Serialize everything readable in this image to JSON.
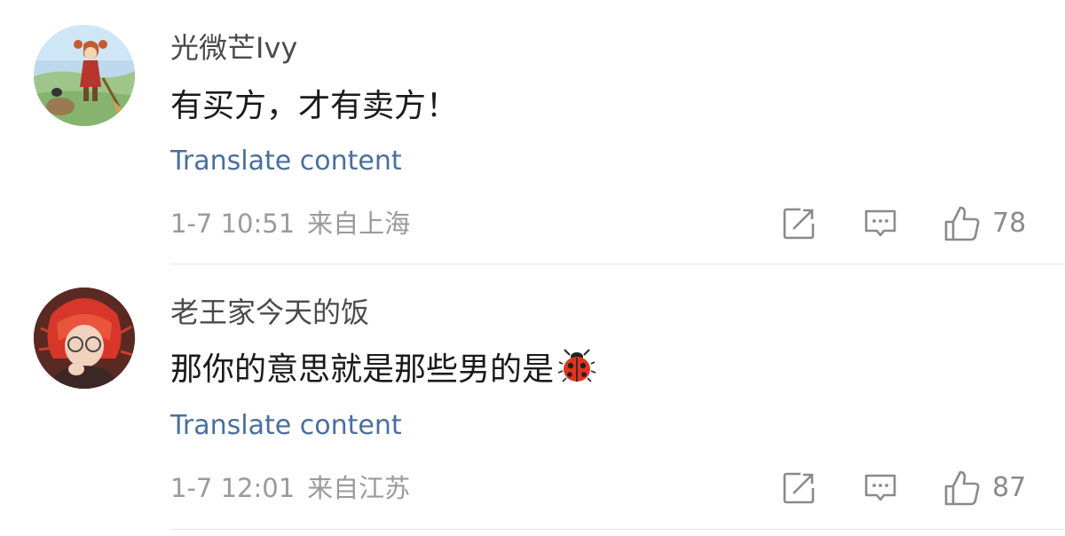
{
  "comments": [
    {
      "username": "光微芒Ivy",
      "text": "有买方，才有卖方！",
      "translate_label": "Translate content",
      "date": "1-7 10:51",
      "location": "来自上海",
      "likes": "78",
      "emoji": ""
    },
    {
      "username": "老王家今天的饭",
      "text": "那你的意思就是那些男的是",
      "translate_label": "Translate content",
      "date": "1-7 12:01",
      "location": "来自江苏",
      "likes": "87",
      "emoji": "ladybug-emoji"
    }
  ],
  "colors": {
    "link": "#4a6f9c",
    "meta": "#9a9a9a",
    "icon": "#8a8a8a",
    "divider": "#e6e6e6"
  },
  "icons": [
    "repost-icon",
    "reply-icon",
    "like-icon"
  ]
}
